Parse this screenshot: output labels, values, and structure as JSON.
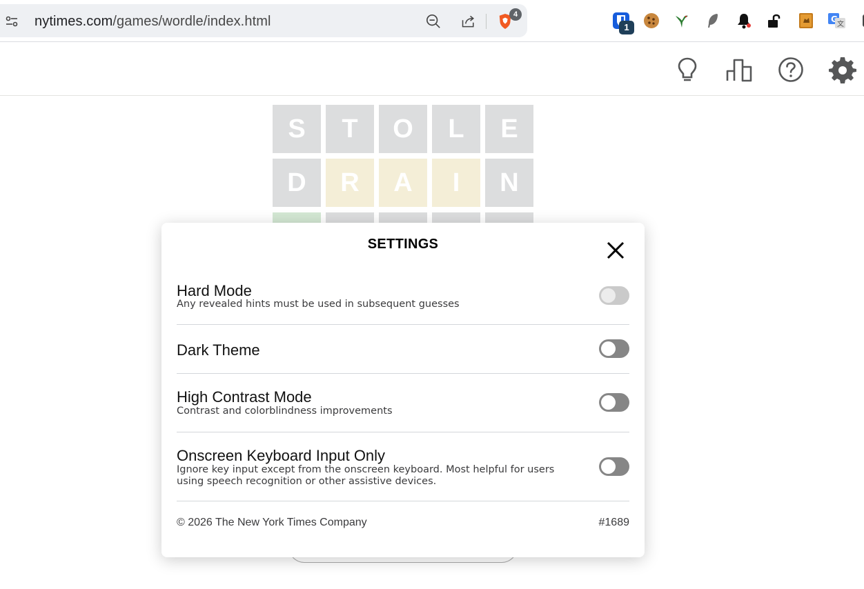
{
  "browser": {
    "url_domain": "nytimes.com",
    "url_path": "/games/wordle/index.html",
    "brave_badge": "4",
    "extension_badge": "1",
    "extensions": [
      "bitwarden-icon",
      "cookie-icon",
      "hummingbird-icon",
      "feather-icon",
      "bell-icon",
      "unlock-icon",
      "notebook-icon",
      "translate-icon"
    ]
  },
  "header": {
    "icons": [
      "lightbulb-icon",
      "stats-icon",
      "help-icon",
      "settings-icon"
    ]
  },
  "board": {
    "rows": [
      {
        "letters": [
          "S",
          "T",
          "O",
          "L",
          "E"
        ],
        "states": [
          "absent",
          "absent",
          "absent",
          "absent",
          "absent"
        ]
      },
      {
        "letters": [
          "D",
          "R",
          "A",
          "I",
          "N"
        ],
        "states": [
          "absent",
          "present",
          "present",
          "present",
          "absent"
        ]
      },
      {
        "letters": [
          "",
          "",
          "",
          "",
          ""
        ],
        "states": [
          "correct",
          "absent",
          "absent",
          "absent",
          "absent"
        ]
      }
    ]
  },
  "settings": {
    "title": "SETTINGS",
    "items": [
      {
        "title": "Hard Mode",
        "description": "Any revealed hints must be used in subsequent guesses",
        "enabled": false,
        "disabled": true
      },
      {
        "title": "Dark Theme",
        "description": "",
        "enabled": false,
        "disabled": false
      },
      {
        "title": "High Contrast Mode",
        "description": "Contrast and colorblindness improvements",
        "enabled": false,
        "disabled": false
      },
      {
        "title": "Onscreen Keyboard Input Only",
        "description": "Ignore key input except from the onscreen keyboard. Most helpful for users using speech recognition or other assistive devices.",
        "enabled": false,
        "disabled": false
      }
    ],
    "copyright": "© 2026 The New York Times Company",
    "puzzle_number": "#1689"
  },
  "colors": {
    "absent": "#b9babc",
    "present": "#e8dcae",
    "correct": "#a6cfa6",
    "toggle_off": "#868686"
  }
}
